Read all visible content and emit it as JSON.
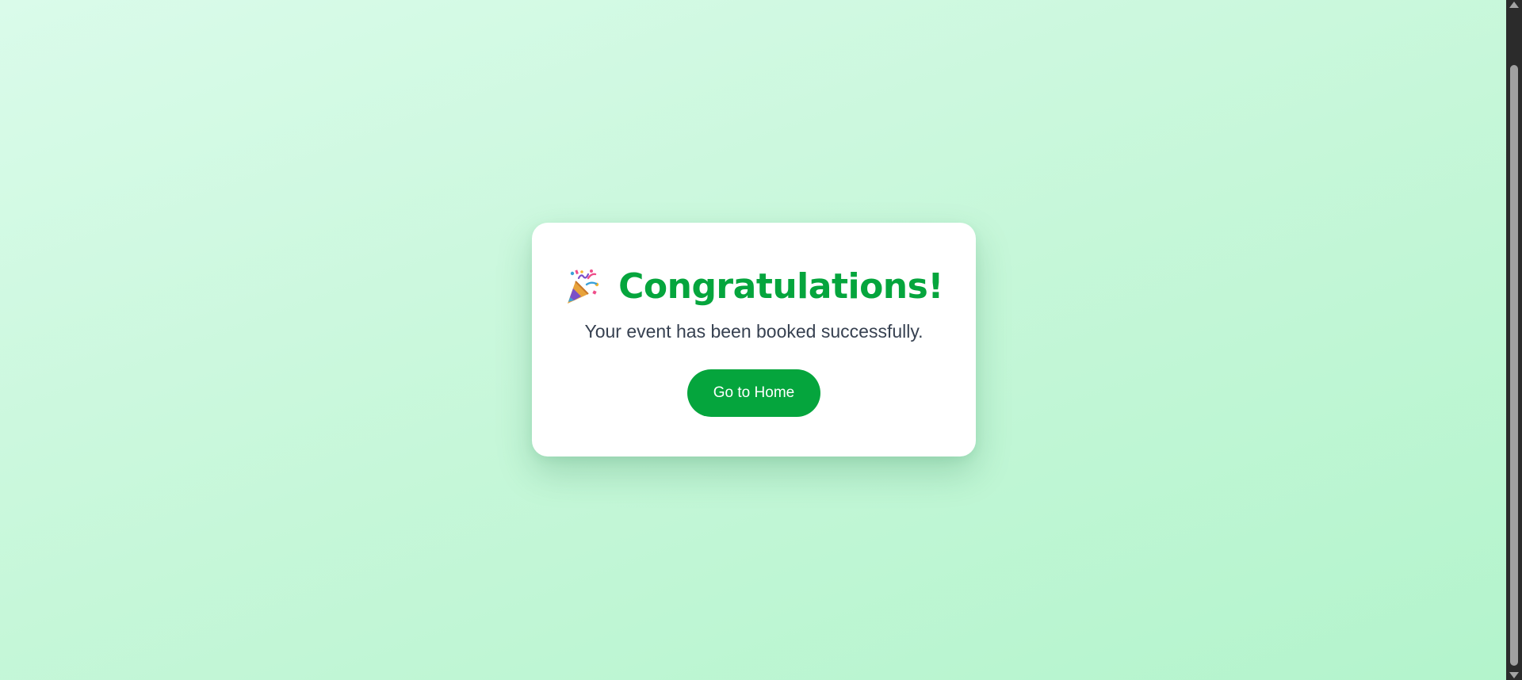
{
  "dialog": {
    "icon": "party-popper-icon",
    "title": "Congratulations!",
    "message": "Your event has been booked successfully.",
    "button_label": "Go to Home"
  },
  "colors": {
    "accent": "#05a53d",
    "background_start": "#dafbea",
    "background_end": "#b3f4cc",
    "text": "#374151"
  }
}
